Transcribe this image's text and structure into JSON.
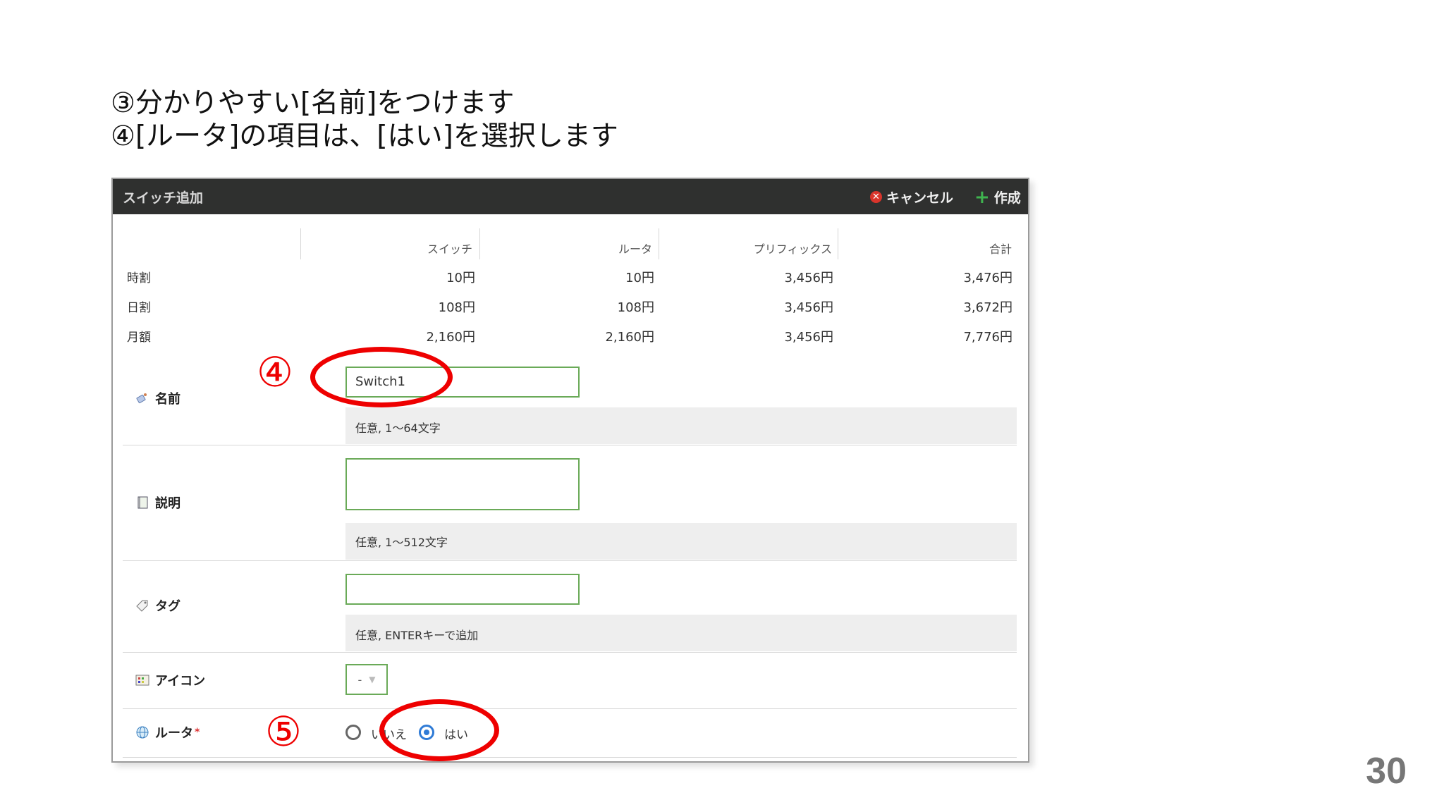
{
  "slide": {
    "line1": "③分かりやすい[名前]をつけます",
    "line2": "④[ルータ]の項目は、[はい]を選択します",
    "page_number": "30"
  },
  "dialog": {
    "title": "スイッチ追加",
    "cancel_label": "キャンセル",
    "create_label": "作成"
  },
  "price_table": {
    "headers": [
      "スイッチ",
      "ルータ",
      "プリフィックス",
      "合計"
    ],
    "rows": [
      {
        "label": "時割",
        "values": [
          "10円",
          "10円",
          "3,456円",
          "3,476円"
        ]
      },
      {
        "label": "日割",
        "values": [
          "108円",
          "108円",
          "3,456円",
          "3,672円"
        ]
      },
      {
        "label": "月額",
        "values": [
          "2,160円",
          "2,160円",
          "3,456円",
          "7,776円"
        ]
      }
    ]
  },
  "form": {
    "name": {
      "label": "名前",
      "value": "Switch1",
      "hint": "任意, 1〜64文字"
    },
    "description": {
      "label": "説明",
      "value": "",
      "hint": "任意, 1〜512文字"
    },
    "tags": {
      "label": "タグ",
      "value": "",
      "hint": "任意, ENTERキーで追加"
    },
    "icon": {
      "label": "アイコン",
      "selected": "-"
    },
    "router": {
      "label": "ルータ",
      "required_mark": "*",
      "options": [
        "いいえ",
        "はい"
      ],
      "selected": "はい"
    }
  },
  "annotations": {
    "step4": "④",
    "step5": "⑤",
    "color": "#e00000"
  },
  "icons": {
    "name": "name-tag-icon",
    "description": "notebook-icon",
    "tags": "tag-icon",
    "icon": "icon-grid-icon",
    "router": "globe-icon"
  }
}
